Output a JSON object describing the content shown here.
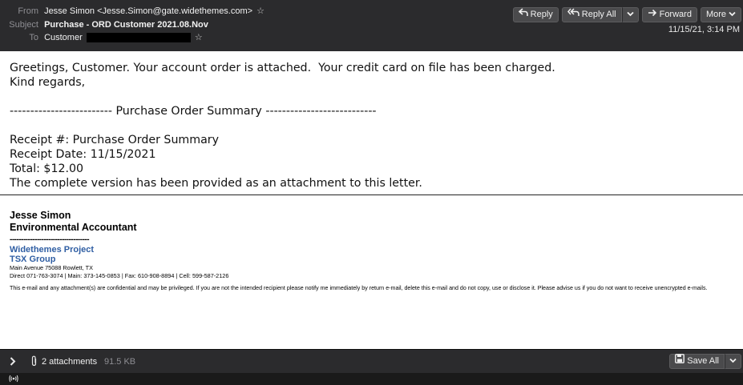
{
  "header": {
    "from_label": "From",
    "from_value": "Jesse Simon <Jesse.Simon@gate.widethemes.com>",
    "subject_label": "Subject",
    "subject_value": "Purchase - ORD Customer 2021.08.Nov",
    "to_label": "To",
    "to_value": "Customer",
    "date": "11/15/21, 3:14 PM",
    "star_icon": "☆"
  },
  "toolbar": {
    "reply_label": "Reply",
    "reply_all_label": "Reply All",
    "forward_label": "Forward",
    "more_label": "More"
  },
  "message": {
    "line1": "Greetings, Customer. Your account order is attached.  Your credit card on file has been charged.",
    "line2": "Kind regards,",
    "summary_line": "------------------------- Purchase Order Summary ---------------------------",
    "receipt_no": "Receipt #: Purchase Order Summary",
    "receipt_date": "Receipt Date: 11/15/2021",
    "total": "Total: $12.00",
    "attachment_note": "The complete version has been provided as an attachment to this letter."
  },
  "signature": {
    "name": "Jesse Simon",
    "title": "Environmental Accountant",
    "dashes": "-----------------------------------",
    "company1": "Widethemes Project",
    "company2": "TSX Group",
    "address": "Main Avenue 75088 Rowlett, TX",
    "phones": "Direct 071-763-3074 | Main: 373-145-0853  | Fax: 610-908-8894 | Cell: 599-587-2126",
    "disclaimer": "This e-mail and any attachment(s) are confidential and may be privileged.  If you are not the intended recipient please notify me immediately by return e-mail, delete this e-mail and do not copy, use or disclose it.  Please advise us if you do not want to receive unencrypted e-mails."
  },
  "attachments": {
    "count_label": "2 attachments",
    "size": "91.5 KB",
    "save_all_label": "Save All"
  },
  "icons": {
    "reply": "reply-arrow-icon",
    "reply_all": "reply-all-icon",
    "forward": "forward-arrow-icon",
    "chevron": "chevron-down-icon",
    "paperclip": "paperclip-icon",
    "save": "save-disk-icon",
    "activity": "activity-wifi-icon"
  }
}
